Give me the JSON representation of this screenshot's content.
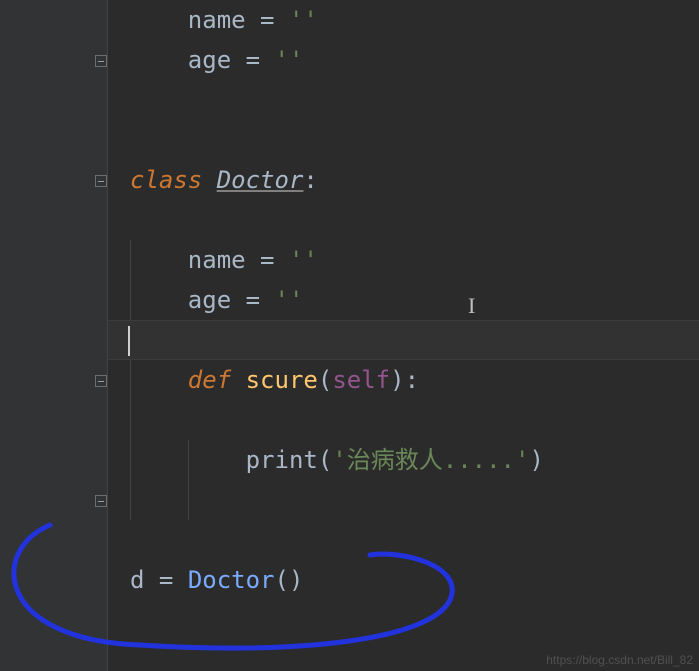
{
  "code": {
    "line1_name": "name",
    "line1_eq": " = ",
    "line1_str": "''",
    "line2_age": "age",
    "line2_eq": " = ",
    "line2_str": "''",
    "line5_class": "class",
    "line5_space": " ",
    "line5_clsname": "Doctor",
    "line5_colon": ":",
    "line8_name": "name",
    "line8_eq": " = ",
    "line8_str": "''",
    "line9_age": "age",
    "line9_eq": " = ",
    "line9_str": "''",
    "line11_def": "def",
    "line11_space": " ",
    "line11_fn": "scure",
    "line11_paren_open": "(",
    "line11_self": "self",
    "line11_paren_close": ")",
    "line11_colon": ":",
    "line13_print": "print",
    "line13_paren_open": "(",
    "line13_str": "'治病救人.....'",
    "line13_paren_close": ")",
    "line15_var": "d",
    "line15_eq": " = ",
    "line15_call": "Doctor",
    "line15_parens": "()"
  },
  "watermark": "https://blog.csdn.net/Bill_82",
  "ibeam_cursor": "I"
}
